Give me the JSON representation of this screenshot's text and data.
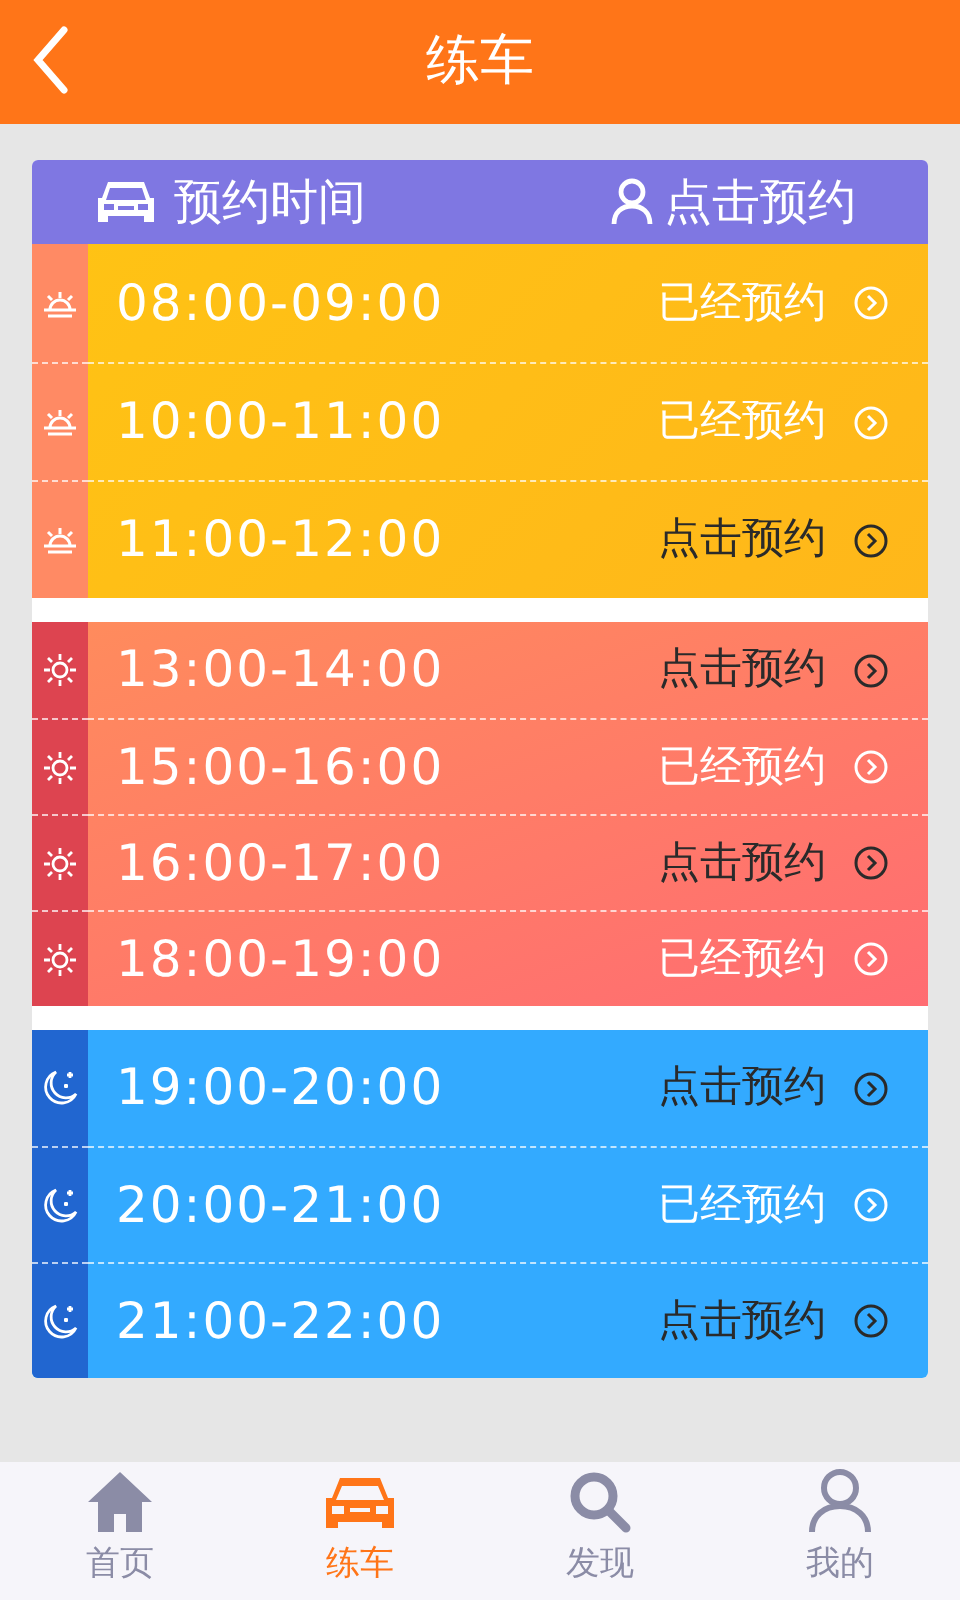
{
  "top_bar": {
    "title": "练车"
  },
  "table_header": {
    "time_label": "预约时间",
    "action_label": "点击预约"
  },
  "sections": [
    {
      "kind": "morning",
      "slots": [
        {
          "time": "08:00-09:00",
          "action": "已经预约",
          "booked": true
        },
        {
          "time": "10:00-11:00",
          "action": "已经预约",
          "booked": true
        },
        {
          "time": "11:00-12:00",
          "action": "点击预约",
          "booked": false
        }
      ]
    },
    {
      "kind": "afternoon",
      "slots": [
        {
          "time": "13:00-14:00",
          "action": "点击预约",
          "booked": false
        },
        {
          "time": "15:00-16:00",
          "action": "已经预约",
          "booked": true
        },
        {
          "time": "16:00-17:00",
          "action": "点击预约",
          "booked": false
        },
        {
          "time": "18:00-19:00",
          "action": "已经预约",
          "booked": true
        }
      ]
    },
    {
      "kind": "evening",
      "slots": [
        {
          "time": "19:00-20:00",
          "action": "点击预约",
          "booked": false
        },
        {
          "time": "20:00-21:00",
          "action": "已经预约",
          "booked": true
        },
        {
          "time": "21:00-22:00",
          "action": "点击预约",
          "booked": false
        }
      ]
    }
  ],
  "tab_bar": [
    {
      "kind": "home",
      "label": "首页",
      "selected": false
    },
    {
      "kind": "car",
      "label": "练车",
      "selected": true
    },
    {
      "kind": "search",
      "label": "发现",
      "selected": false
    },
    {
      "kind": "person",
      "label": "我的",
      "selected": false
    }
  ]
}
